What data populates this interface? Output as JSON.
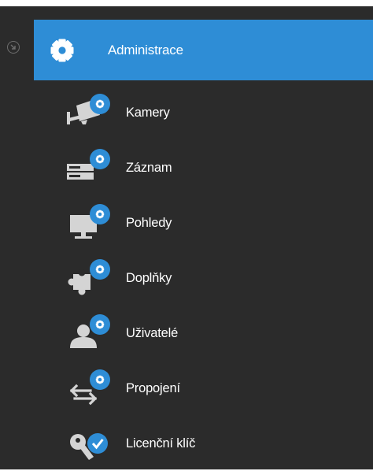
{
  "colors": {
    "panel_background": "#2b2b2b",
    "header_background": "#2e8dd6",
    "badge_blue": "#2e8dd6",
    "icon_grey": "#d4d4d4",
    "text": "#ffffff"
  },
  "collapse_button": {
    "icon": "collapse-arrow-icon"
  },
  "header": {
    "icon": "gear-icon",
    "title": "Administrace"
  },
  "menu": {
    "items": [
      {
        "label": "Kamery",
        "icon": "camera-settings-icon"
      },
      {
        "label": "Záznam",
        "icon": "recorder-settings-icon"
      },
      {
        "label": "Pohledy",
        "icon": "monitor-settings-icon"
      },
      {
        "label": "Doplňky",
        "icon": "puzzle-settings-icon"
      },
      {
        "label": "Uživatelé",
        "icon": "user-settings-icon"
      },
      {
        "label": "Propojení",
        "icon": "connection-settings-icon"
      },
      {
        "label": "Licenční klíč",
        "icon": "license-key-check-icon"
      }
    ]
  }
}
